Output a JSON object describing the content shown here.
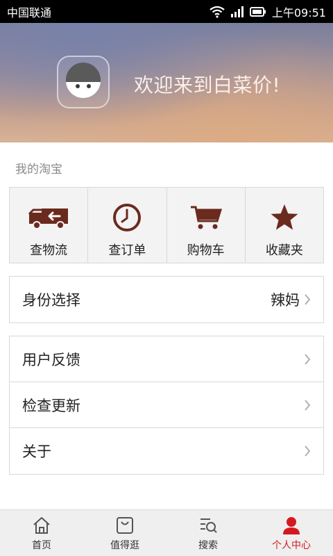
{
  "colors": {
    "brown": "#6b2a1e",
    "active_red": "#d4191e",
    "chevron": "#b0b0b0"
  },
  "status_bar": {
    "carrier": "中国联通",
    "time": "上午09:51"
  },
  "header": {
    "welcome": "欢迎来到白菜价!",
    "avatar_icon": "mascot-icon"
  },
  "section": {
    "label": "我的淘宝"
  },
  "shortcuts": [
    {
      "label": "查物流",
      "icon": "truck-icon"
    },
    {
      "label": "查订单",
      "icon": "clock-icon"
    },
    {
      "label": "购物车",
      "icon": "cart-icon"
    },
    {
      "label": "收藏夹",
      "icon": "star-icon"
    }
  ],
  "identity": {
    "label": "身份选择",
    "value": "辣妈"
  },
  "menu": [
    {
      "label": "用户反馈"
    },
    {
      "label": "检查更新"
    },
    {
      "label": "关于"
    }
  ],
  "bottom_nav": [
    {
      "label": "首页",
      "icon": "home-icon"
    },
    {
      "label": "值得逛",
      "icon": "shopping-bag-icon"
    },
    {
      "label": "搜索",
      "icon": "search-list-icon"
    },
    {
      "label": "个人中心",
      "icon": "person-icon",
      "active": true
    }
  ]
}
